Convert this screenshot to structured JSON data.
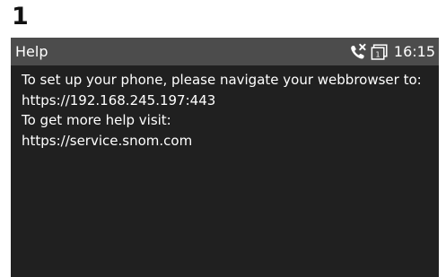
{
  "step_number": "1",
  "titlebar": {
    "title": "Help",
    "clock": "16:15",
    "icons": [
      "missed-call-icon",
      "message-counter-icon"
    ],
    "message_count": "1"
  },
  "content": {
    "lines": [
      "To set up your phone, please navigate your webbrowser to:",
      "https://192.168.245.197:443",
      "To get more help visit:",
      "https://service.snom.com"
    ]
  },
  "colors": {
    "screen_background": "#202020",
    "titlebar_background": "#4c4c4c",
    "text": "#ffffff"
  }
}
